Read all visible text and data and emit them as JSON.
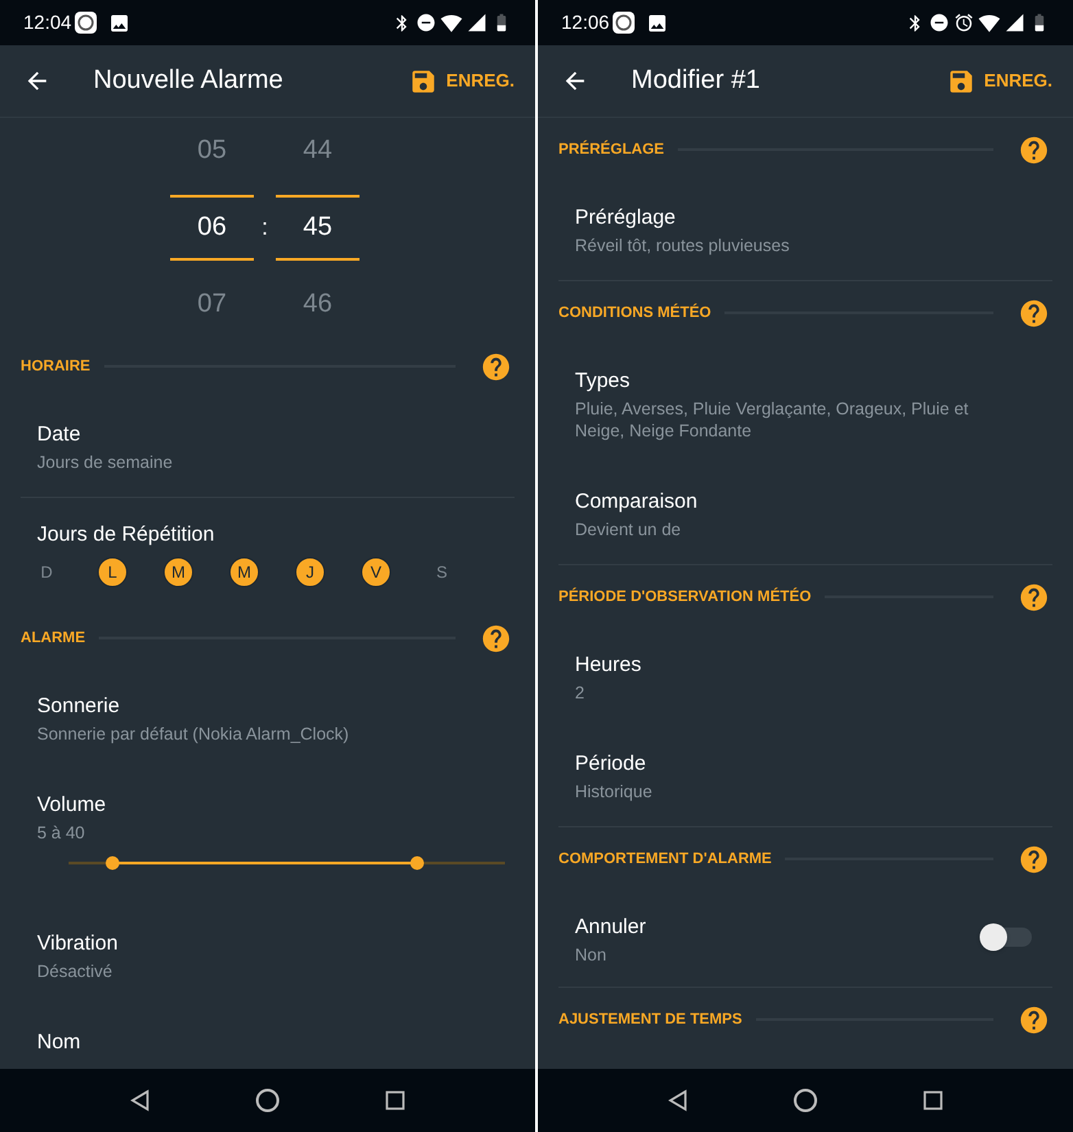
{
  "screens": [
    {
      "status": {
        "time": "12:04"
      },
      "title_text": "Nouvelle Alarme",
      "save_label": "ENREG.",
      "picker": {
        "separator": ":",
        "hours": [
          {
            "value": "05",
            "selected": false
          },
          {
            "value": "06",
            "selected": true
          },
          {
            "value": "07",
            "selected": false
          }
        ],
        "minutes": [
          {
            "value": "44",
            "selected": false
          },
          {
            "value": "45",
            "selected": true
          },
          {
            "value": "46",
            "selected": false
          }
        ]
      },
      "sections": [
        {
          "title": "HORAIRE",
          "items": [
            {
              "kind": "setting",
              "title": "Date",
              "subtitle": "Jours de semaine",
              "divider": true
            },
            {
              "kind": "days",
              "title": "Jours de Répétition",
              "days": [
                {
                  "label": "D",
                  "selected": false
                },
                {
                  "label": "L",
                  "selected": true
                },
                {
                  "label": "M",
                  "selected": true
                },
                {
                  "label": "M",
                  "selected": true
                },
                {
                  "label": "J",
                  "selected": true
                },
                {
                  "label": "V",
                  "selected": true
                },
                {
                  "label": "S",
                  "selected": false
                }
              ]
            }
          ]
        },
        {
          "title": "ALARME",
          "items": [
            {
              "kind": "setting",
              "title": "Sonnerie",
              "subtitle": "Sonnerie par défaut (Nokia Alarm_Clock)"
            },
            {
              "kind": "range",
              "title": "Volume",
              "subtitle": "5 à 40",
              "thumbs": [
                {
                  "level": 0.1
                },
                {
                  "level": 0.8
                }
              ]
            },
            {
              "kind": "setting",
              "title": "Vibration",
              "subtitle": "Désactivé"
            },
            {
              "kind": "setting",
              "title": "Nom"
            }
          ]
        }
      ]
    },
    {
      "status": {
        "time": "12:06",
        "alarm_set": true
      },
      "title_text": "Modifier #1",
      "save_label": "ENREG.",
      "sections": [
        {
          "title": "PRÉRÉGLAGE",
          "items": [
            {
              "kind": "setting",
              "title": "Préréglage",
              "subtitle": "Réveil tôt, routes pluvieuses",
              "divider": true
            }
          ]
        },
        {
          "title": "CONDITIONS MÉTÉO",
          "items": [
            {
              "kind": "setting",
              "title": "Types",
              "subtitle": "Pluie, Averses, Pluie Verglaçante, Orageux, Pluie et Neige, Neige Fondante"
            },
            {
              "kind": "setting",
              "title": "Comparaison",
              "subtitle": "Devient un de",
              "divider": true
            }
          ]
        },
        {
          "title": "PÉRIODE D'OBSERVATION MÉTÉO",
          "items": [
            {
              "kind": "setting",
              "title": "Heures",
              "subtitle": "2"
            },
            {
              "kind": "setting",
              "title": "Période",
              "subtitle": "Historique",
              "divider": true
            }
          ]
        },
        {
          "title": "COMPORTEMENT D'ALARME",
          "items": [
            {
              "kind": "toggle",
              "title": "Annuler",
              "subtitle": "Non",
              "on": false,
              "divider": true
            }
          ]
        },
        {
          "title": "AJUSTEMENT DE TEMPS"
        }
      ]
    }
  ]
}
